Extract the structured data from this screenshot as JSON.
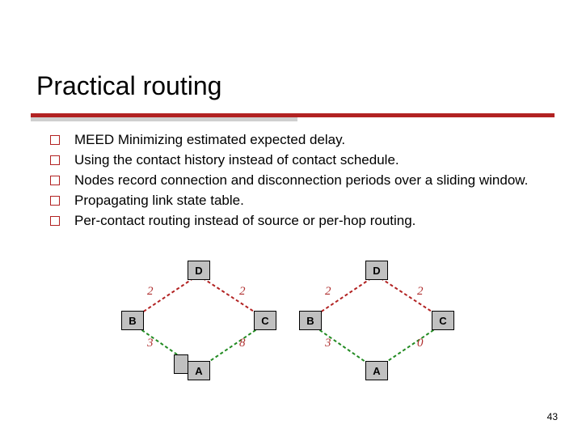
{
  "title": "Practical routing",
  "bullets": [
    "MEED Minimizing estimated expected delay.",
    "Using the contact history instead of contact schedule.",
    "Nodes record connection and disconnection periods over a sliding window.",
    "Propagating link state table.",
    "Per-contact routing instead of source or per-hop routing."
  ],
  "diagram": {
    "left": {
      "top": "D",
      "left": "B",
      "right": "C",
      "bottom": "A",
      "edge_tl": "2",
      "edge_tr": "2",
      "edge_bl": "3",
      "edge_br": "8"
    },
    "right": {
      "top": "D",
      "left": "B",
      "right": "C",
      "bottom": "A",
      "edge_tl": "2",
      "edge_tr": "2",
      "edge_bl": "3",
      "edge_br": "0"
    }
  },
  "page_number": "43"
}
